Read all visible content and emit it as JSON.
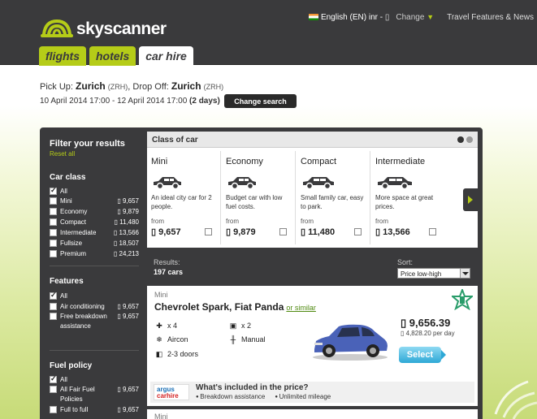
{
  "brand": {
    "name": "skyscanner",
    "accent": "#b5cc18",
    "dark": "#3a3a3c"
  },
  "toplinks": {
    "language": "English (EN) inr -",
    "change": "Change",
    "features": "Travel Features & News"
  },
  "tabs": [
    {
      "label": "flights"
    },
    {
      "label": "hotels"
    },
    {
      "label": "car hire"
    }
  ],
  "search": {
    "pickup_label": "Pick Up:",
    "pickup_city": "Zurich",
    "pickup_code": "(ZRH)",
    "dropoff_label": ", Drop Off:",
    "dropoff_city": "Zurich",
    "dropoff_code": "(ZRH)",
    "dates": "10 April 2014 17:00 - 12 April 2014 17:00",
    "duration": "(2 days)",
    "change_button": "Change search"
  },
  "sidebar": {
    "title": "Filter your results",
    "reset": "Reset all",
    "car_class": {
      "title": "Car class",
      "items": [
        {
          "label": "All",
          "count": "",
          "checked": true
        },
        {
          "label": "Mini",
          "count": "9,657",
          "checked": false
        },
        {
          "label": "Economy",
          "count": "9,879",
          "checked": false
        },
        {
          "label": "Compact",
          "count": "11,480",
          "checked": false
        },
        {
          "label": "Intermediate",
          "count": "13,566",
          "checked": false
        },
        {
          "label": "Fullsize",
          "count": "18,507",
          "checked": false
        },
        {
          "label": "Premium",
          "count": "24,213",
          "checked": false
        }
      ]
    },
    "features": {
      "title": "Features",
      "items": [
        {
          "label": "All",
          "count": "",
          "checked": true
        },
        {
          "label": "Air conditioning",
          "count": "9,657",
          "checked": false
        },
        {
          "label": "Free breakdown assistance",
          "count": "9,657",
          "checked": false
        }
      ]
    },
    "fuel": {
      "title": "Fuel policy",
      "items": [
        {
          "label": "All",
          "count": "",
          "checked": true
        },
        {
          "label": "All Fair Fuel Policies",
          "count": "9,657",
          "checked": false
        },
        {
          "label": "Full to full",
          "count": "9,657",
          "checked": false
        }
      ]
    }
  },
  "class_of_car": {
    "title": "Class of car",
    "cards": [
      {
        "name": "Mini",
        "desc": "An ideal city car for 2 people.",
        "from": "from",
        "price": "9,657"
      },
      {
        "name": "Economy",
        "desc": "Budget car with low fuel costs.",
        "from": "from",
        "price": "9,879"
      },
      {
        "name": "Compact",
        "desc": "Small family car, easy to park.",
        "from": "from",
        "price": "11,480"
      },
      {
        "name": "Intermediate",
        "desc": "More space at great prices.",
        "from": "from",
        "price": "13,566"
      }
    ]
  },
  "results": {
    "label": "Results:",
    "count": "197 cars",
    "sort_label": "Sort:",
    "sort_value": "Price low-high"
  },
  "result_item": {
    "class": "Mini",
    "name": "Chevrolet Spark, Fiat Panda",
    "similar": "or similar",
    "seats": "x 4",
    "bags": "x 2",
    "aircon": "Aircon",
    "transmission": "Manual",
    "doors": "2-3 doors",
    "price": "9,656.39",
    "per_day": "4,828.20 per day",
    "select": "Select",
    "included_title": "What's included in the price?",
    "included": [
      "Breakdown assistance",
      "Unlimited mileage"
    ],
    "argus_top": "argus",
    "argus_bottom": "carhire"
  },
  "result_item2": {
    "class": "Mini"
  }
}
